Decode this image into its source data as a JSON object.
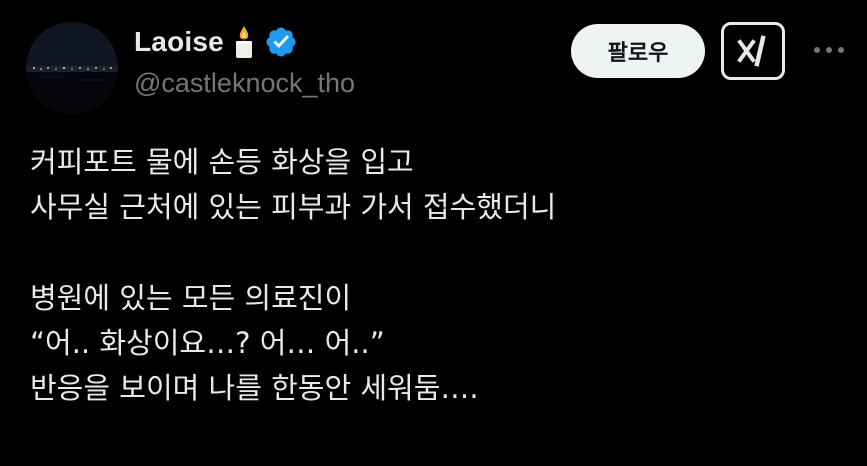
{
  "author": {
    "display_name": "Laoise",
    "handle": "@castleknock_tho",
    "badge_icon": "candle-icon",
    "verified_icon": "verified-badge-icon",
    "verified_color": "#1d9bf0"
  },
  "actions": {
    "follow_label": "팔로우",
    "grok_icon": "grok-icon",
    "more_icon": "more-icon"
  },
  "tweet": {
    "lines": [
      "커피포트 물에 손등 화상을 입고",
      "사무실 근처에 있는 피부과 가서 접수했더니",
      "",
      "병원에 있는 모든 의료진이",
      "“어.. 화상이요…? 어… 어..”",
      "반응을 보이며 나를 한동안 세워둠…."
    ]
  },
  "colors": {
    "background": "#000000",
    "text_primary": "#e7e9ea",
    "text_secondary": "#71767b",
    "button_bg": "#eff3f4",
    "button_text": "#0f1419"
  }
}
